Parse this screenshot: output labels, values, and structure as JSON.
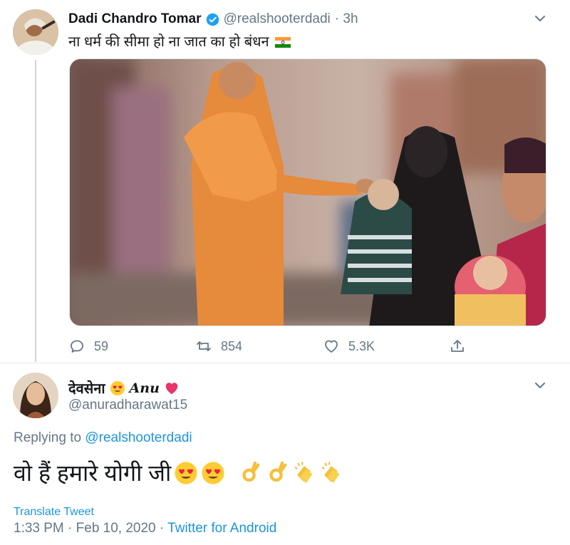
{
  "tweet": {
    "author_name": "Dadi Chandro Tomar",
    "handle": "@realshooterdadi",
    "time": "· 3h",
    "text": "ना धर्म की सीमा हो ना जात का हो बंधन",
    "stats": {
      "replies": "59",
      "retweets": "854",
      "likes": "5.3K"
    }
  },
  "reply": {
    "author_name": "देवसेना",
    "author_suffix": "Anu",
    "handle": "@anuradharawat15",
    "replying_label": "Replying to",
    "replying_handle": "@realshooterdadi",
    "text": "वो हैं हमारे योगी जी",
    "translate": "Translate Tweet",
    "timestamp": "1:33 PM · Feb 10, 2020 · ",
    "source": "Twitter for Android"
  },
  "icons": {
    "verified": "verified-badge-icon",
    "reply": "reply-icon",
    "retweet": "retweet-icon",
    "like": "heart-icon",
    "share": "share-icon",
    "more": "chevron-down-icon"
  },
  "colors": {
    "accent": "#1b95e0",
    "muted": "#657786",
    "text": "#14171a"
  }
}
